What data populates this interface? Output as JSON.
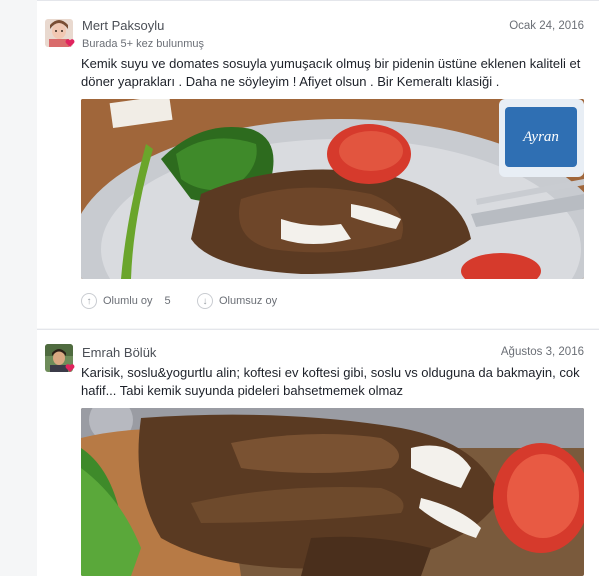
{
  "reviews": [
    {
      "author": "Mert Paksoylu",
      "meta": "Burada 5+ kez bulunmuş",
      "date": "Ocak 24, 2016",
      "text": "Kemik suyu ve domates sosuyla yumuşacık olmuş bir pidenin üstüne eklenen kaliteli et döner yaprakları . Daha ne söyleyim ! Afiyet olsun . Bir Kemeraltı klasiği .",
      "upvote_label": "Olumlu oy",
      "upvote_count": "5",
      "downvote_label": "Olumsuz oy",
      "photo_cup_text": "Ayran"
    },
    {
      "author": "Emrah Bölük",
      "date": "Ağustos 3, 2016",
      "text": "Karisik, soslu&yogurtlu alin; koftesi ev koftesi gibi, soslu vs olduguna da bakmayin, cok hafif... Tabi kemik suyunda pideleri bahsetmemek olmaz"
    }
  ],
  "icons": {
    "upvote": "arrow-up-icon",
    "downvote": "arrow-down-icon",
    "heart": "heart-icon"
  },
  "colors": {
    "heart": "#e0245e",
    "text": "#1d2129",
    "muted": "#6b6f76"
  }
}
